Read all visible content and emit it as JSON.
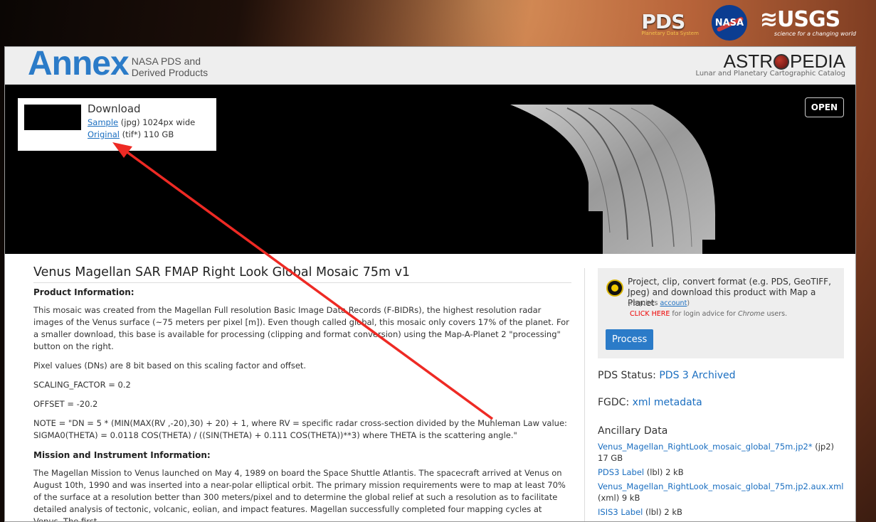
{
  "top_logos": {
    "pds": {
      "text": "PDS",
      "sub": "Planetary Data System"
    },
    "nasa": {
      "text": "NASA"
    },
    "usgs": {
      "text": "USGS",
      "sub": "science for a changing world"
    }
  },
  "header": {
    "annex_word": "Annex",
    "annex_sub_line1": "NASA PDS and",
    "annex_sub_line2": "Derived Products",
    "astro_left": "ASTR",
    "astro_right": "PEDIA",
    "astro_tag": "Lunar and Planetary Cartographic Catalog"
  },
  "download": {
    "title": "Download",
    "sample_link": "Sample",
    "sample_info": "(jpg) 1024px wide",
    "original_link": "Original",
    "original_info": "(tif*) 110 GB"
  },
  "open_button": "OPEN",
  "product": {
    "title": "Venus Magellan SAR FMAP Right Look Global Mosaic 75m v1",
    "info_heading": "Product Information:",
    "p1": "This mosaic was created from the Magellan Full resolution Basic Image Data Records (F-BIDRs), the highest resolution radar images of the Venus surface (~75 meters per pixel [m]). Even though called global, this mosaic only covers 17% of the planet. For a smaller download, this base is available for processing (clipping and format conversion) using the Map-A-Planet 2 \"processing\" button on the right.",
    "p2": "Pixel values (DNs) are 8 bit based on this scaling factor and offset.",
    "p3": "SCALING_FACTOR = 0.2",
    "p4": "OFFSET = -20.2",
    "p5": "NOTE = \"DN = 5 * (MIN(MAX(RV ,-20),30) + 20) + 1, where RV = specific radar cross-section divided by the Muhleman Law value: SIGMA0(THETA) = 0.0118 COS(THETA) / ((SIN(THETA) + 0.111 COS(THETA))**3) where THETA is the scattering angle.\"",
    "mission_heading": "Mission and Instrument Information:",
    "p6": "The Magellan Mission to Venus launched on May 4, 1989 on board the Space Shuttle Atlantis. The spacecraft arrived at Venus on August 10th, 1990 and was inserted into a near-polar elliptical orbit. The primary mission requirements were to map at least 70% of the surface at a resolution better than 300 meters/pixel and to determine the global relief at such a resolution as to facilitate detailed analysis of tectonic, volcanic, eolian, and impact features. Magellan successfully completed four mapping cycles at Venus. The first"
  },
  "sidebar": {
    "map_text": "Project, clip, convert format (e.g. PDS, GeoTIFF, Jpeg) and download this product with Map a Planet",
    "requires_prefix": "(requires ",
    "account_link": "account",
    "requires_suffix": ")",
    "click_here": "CLICK HERE",
    "chrome_text_pre": " for login advice for ",
    "chrome_word": "Chrome",
    "chrome_text_post": " users.",
    "process_button": "Process",
    "pds_status_label": "PDS Status: ",
    "pds_status_value": "PDS 3 Archived",
    "fgdc_label": "FGDC: ",
    "fgdc_value": "xml metadata",
    "ancillary_title": "Ancillary Data",
    "ancillary": [
      {
        "link": "Venus_Magellan_RightLook_mosaic_global_75m.jp2*",
        "info": " (jp2)"
      },
      {
        "link": "",
        "info": "17 GB"
      },
      {
        "link": "PDS3 Label",
        "info": " (lbl) 2 kB"
      },
      {
        "link": "Venus_Magellan_RightLook_mosaic_global_75m.jp2.aux.xml",
        "info": ""
      },
      {
        "link": "",
        "info": "(xml) 9 kB"
      },
      {
        "link": "ISIS3 Label",
        "info": " (lbl) 2 kB"
      }
    ]
  },
  "colors": {
    "link": "#1a6ec0",
    "accent": "#2b7bc8",
    "annotation_arrow": "#ee2a24"
  }
}
